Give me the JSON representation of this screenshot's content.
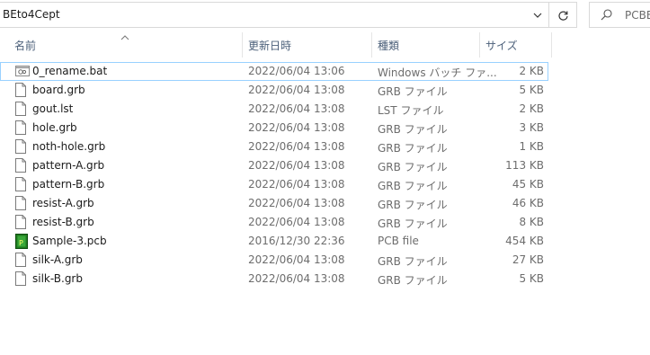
{
  "address_bar": {
    "path": "BEto4Cept"
  },
  "search": {
    "placeholder": "PCBE"
  },
  "columns": {
    "name": "名前",
    "date": "更新日時",
    "type": "種類",
    "size": "サイズ"
  },
  "files": [
    {
      "name": "0_rename.bat",
      "date": "2022/06/04 13:06",
      "type": "Windows バッチ ファ...",
      "size": "2 KB",
      "icon": "batch-file-icon"
    },
    {
      "name": "board.grb",
      "date": "2022/06/04 13:08",
      "type": "GRB ファイル",
      "size": "5 KB",
      "icon": "file-icon"
    },
    {
      "name": "gout.lst",
      "date": "2022/06/04 13:08",
      "type": "LST ファイル",
      "size": "2 KB",
      "icon": "file-icon"
    },
    {
      "name": "hole.grb",
      "date": "2022/06/04 13:08",
      "type": "GRB ファイル",
      "size": "3 KB",
      "icon": "file-icon"
    },
    {
      "name": "noth-hole.grb",
      "date": "2022/06/04 13:08",
      "type": "GRB ファイル",
      "size": "1 KB",
      "icon": "file-icon"
    },
    {
      "name": "pattern-A.grb",
      "date": "2022/06/04 13:08",
      "type": "GRB ファイル",
      "size": "113 KB",
      "icon": "file-icon"
    },
    {
      "name": "pattern-B.grb",
      "date": "2022/06/04 13:08",
      "type": "GRB ファイル",
      "size": "45 KB",
      "icon": "file-icon"
    },
    {
      "name": "resist-A.grb",
      "date": "2022/06/04 13:08",
      "type": "GRB ファイル",
      "size": "46 KB",
      "icon": "file-icon"
    },
    {
      "name": "resist-B.grb",
      "date": "2022/06/04 13:08",
      "type": "GRB ファイル",
      "size": "8 KB",
      "icon": "file-icon"
    },
    {
      "name": "Sample-3.pcb",
      "date": "2016/12/30 22:36",
      "type": "PCB file",
      "size": "454 KB",
      "icon": "pcb-file-icon"
    },
    {
      "name": "silk-A.grb",
      "date": "2022/06/04 13:08",
      "type": "GRB ファイル",
      "size": "27 KB",
      "icon": "file-icon"
    },
    {
      "name": "silk-B.grb",
      "date": "2022/06/04 13:08",
      "type": "GRB ファイル",
      "size": "5 KB",
      "icon": "file-icon"
    }
  ]
}
